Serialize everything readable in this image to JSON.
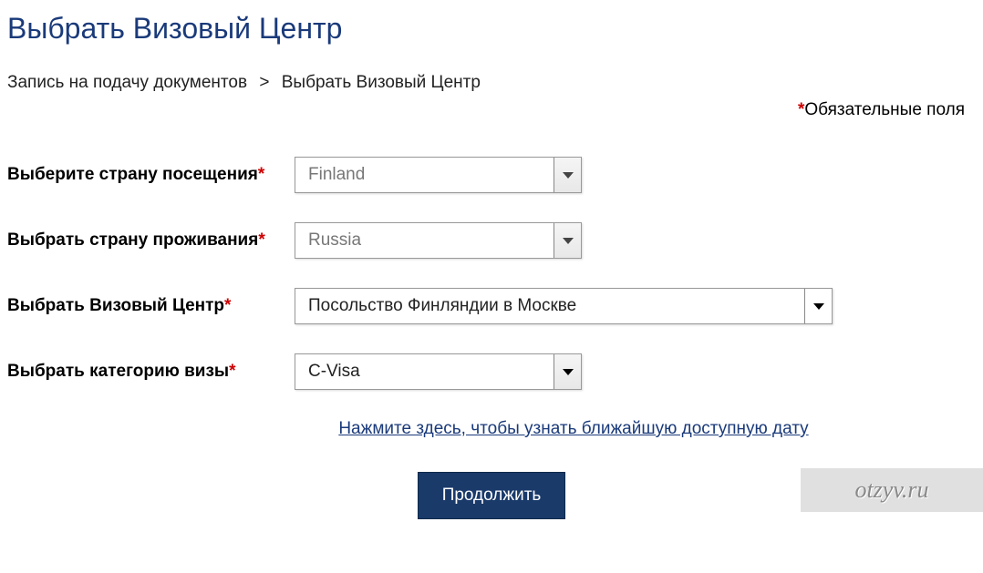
{
  "page_title": "Выбрать Визовый Центр",
  "breadcrumb": {
    "item1": "Запись на подачу документов",
    "sep": ">",
    "item2": "Выбрать Визовый Центр"
  },
  "required_hint": "Обязательные поля",
  "asterisk": "*",
  "form": {
    "country_visit": {
      "label": "Выберите страну посещения",
      "value": "Finland"
    },
    "country_residence": {
      "label": "Выбрать страну проживания",
      "value": "Russia"
    },
    "visa_center": {
      "label": "Выбрать Визовый Центр",
      "value": "Посольство Финляндии в Москве"
    },
    "visa_category": {
      "label": "Выбрать категорию визы",
      "value": "C-Visa"
    }
  },
  "info_link": "Нажмите здесь, чтобы узнать ближайшую доступную дату",
  "continue_button": "Продолжить",
  "watermark": "otzyv.ru",
  "colors": {
    "primary": "#1a3a7a",
    "button": "#1a3a6a",
    "required": "#c00"
  }
}
